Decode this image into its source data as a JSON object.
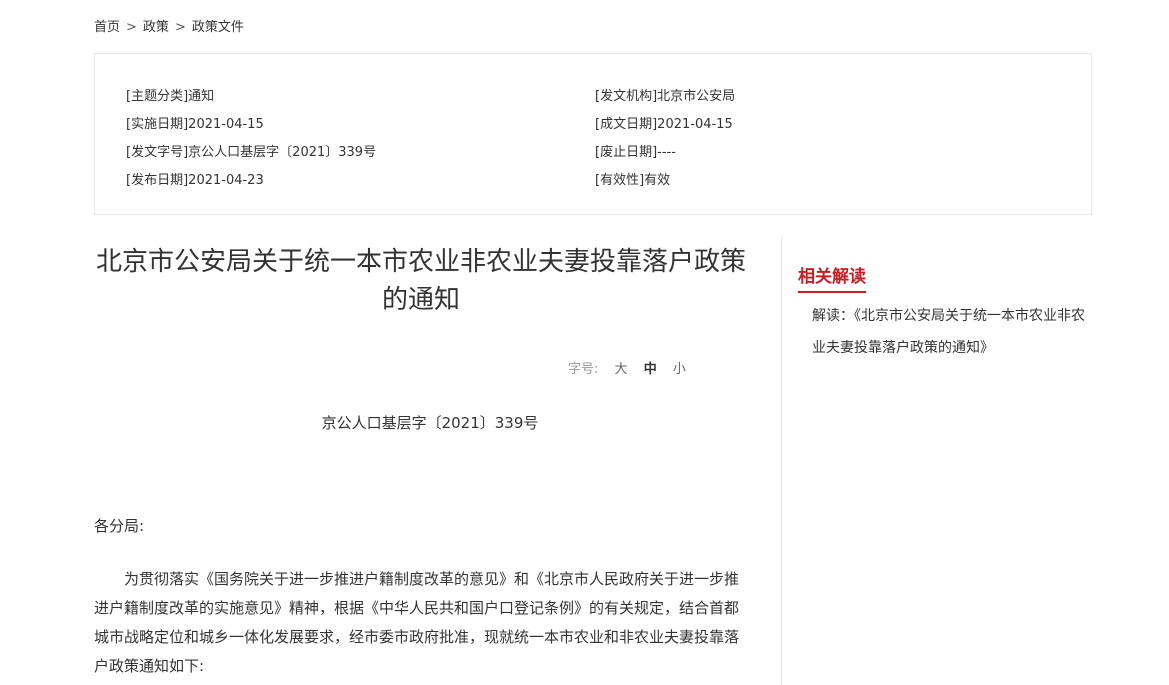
{
  "breadcrumb": {
    "home": "首页",
    "sep": ">",
    "policy": "政策",
    "current": "政策文件"
  },
  "meta": {
    "topic_key": "主题分类",
    "topic": "通知",
    "issuer_key": "发文机构",
    "issuer": "北京市公安局",
    "effective_key": "实施日期",
    "effective": "2021-04-15",
    "created_key": "成文日期",
    "created": "2021-04-15",
    "docno_key": "发文字号",
    "docno": "京公人口基层字〔2021〕339号",
    "repeal_key": "废止日期",
    "repeal": "----",
    "published_key": "发布日期",
    "published": "2021-04-23",
    "validity_key": "有效性",
    "validity": "有效"
  },
  "article": {
    "title": "北京市公安局关于统一本市农业非农业夫妻投靠落户政策的通知",
    "font_label": "字号:",
    "font_large": "大",
    "font_medium": "中",
    "font_small": "小",
    "doc_number": "京公人口基层字〔2021〕339号",
    "salutation": "各分局:",
    "paragraph1": "为贯彻落实《国务院关于进一步推进户籍制度改革的意见》和《北京市人民政府关于进一步推进户籍制度改革的实施意见》精神，根据《中华人民共和国户口登记条例》的有关规定，结合首都城市战略定位和城乡一体化发展要求，经市委市政府批准，现就统一本市农业和非农业夫妻投靠落户政策通知如下:"
  },
  "sidebar": {
    "title": "相关解读",
    "link": "解读：《北京市公安局关于统一本市农业非农业夫妻投靠落户政策的通知》"
  },
  "colors": {
    "accent": "#c81d25",
    "text": "#333333",
    "muted": "#999999"
  }
}
